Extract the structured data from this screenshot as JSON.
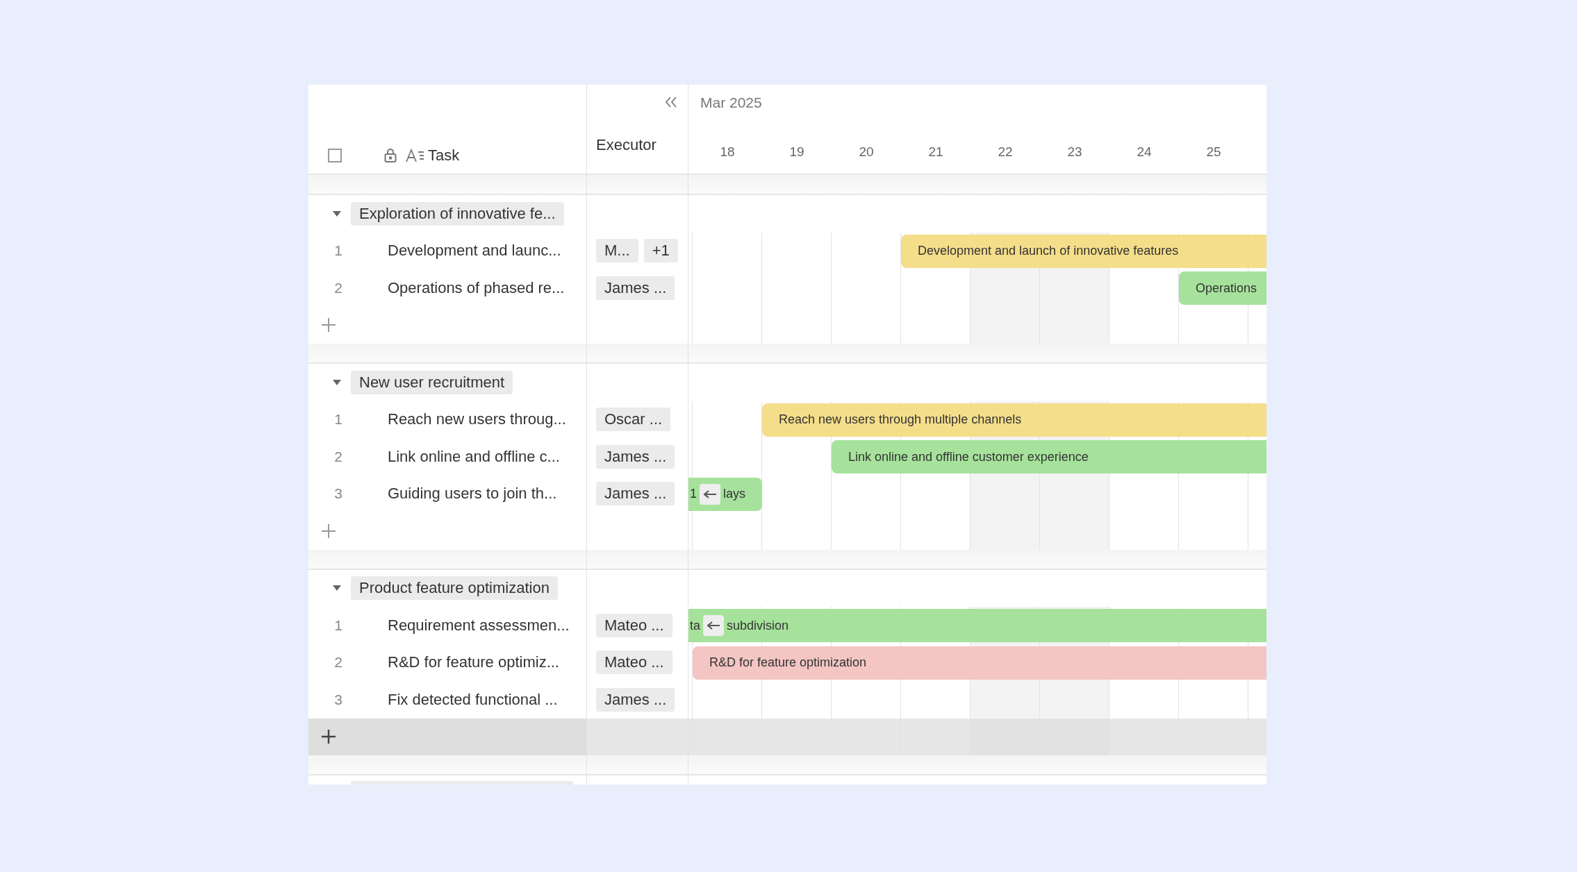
{
  "header": {
    "select_all": {
      "checked": false
    },
    "columns": [
      "Task",
      "Executor"
    ],
    "month": "Mar 2025"
  },
  "days": [
    {
      "label": "18",
      "weekend": false
    },
    {
      "label": "19",
      "weekend": false
    },
    {
      "label": "20",
      "weekend": false
    },
    {
      "label": "21",
      "weekend": false
    },
    {
      "label": "22",
      "weekend": true
    },
    {
      "label": "23",
      "weekend": true
    },
    {
      "label": "24",
      "weekend": false
    },
    {
      "label": "25",
      "weekend": false
    }
  ],
  "groups": [
    {
      "kind": "group",
      "title": "Exploration of innovative fe...",
      "expanded": true,
      "add_row_hovered": false,
      "tasks": [
        {
          "number": "1",
          "name": "Development and launc...",
          "executors": [
            "M...",
            "+1"
          ],
          "bar": {
            "label": "Development and launch of innovative features",
            "color": "#f5de8a"
          }
        },
        {
          "number": "2",
          "name": "Operations of phased re...",
          "executors": [
            "James ..."
          ],
          "bar": {
            "label": "Operations",
            "color": "#a6e29b"
          }
        }
      ]
    },
    {
      "kind": "group",
      "title": "New user recruitment",
      "expanded": true,
      "add_row_hovered": false,
      "tasks": [
        {
          "number": "1",
          "name": "Reach new users throug...",
          "executors": [
            "Oscar ..."
          ],
          "bar": {
            "label": "Reach new users through multiple channels",
            "color": "#f5de8a"
          }
        },
        {
          "number": "2",
          "name": "Link online and offline c...",
          "executors": [
            "James ..."
          ],
          "bar": {
            "label": "Link online and offline customer experience",
            "color": "#a6e29b"
          }
        },
        {
          "number": "3",
          "name": "Guiding users to join th...",
          "executors": [
            "James ..."
          ],
          "bar": {
            "label_before": "1",
            "label_after": "lays",
            "color": "#a6e29b",
            "kind": "clipped"
          }
        }
      ]
    },
    {
      "kind": "group",
      "title": "Product feature optimization",
      "expanded": true,
      "add_row_hovered": true,
      "tasks": [
        {
          "number": "1",
          "name": "Requirement assessmen...",
          "executors": [
            "Mateo ..."
          ],
          "bar": {
            "label_before": "ta",
            "label_after": "subdivision",
            "color": "#a6e29b",
            "kind": "clipped"
          }
        },
        {
          "number": "2",
          "name": "R&D for feature optimiz...",
          "executors": [
            "Mateo ..."
          ],
          "bar": {
            "label": "R&D for feature optimization",
            "color": "#f3c5c3"
          }
        },
        {
          "number": "3",
          "name": "Fix detected functional ...",
          "executors": [
            "James ..."
          ]
        }
      ]
    },
    {
      "kind": "cut-off"
    }
  ]
}
